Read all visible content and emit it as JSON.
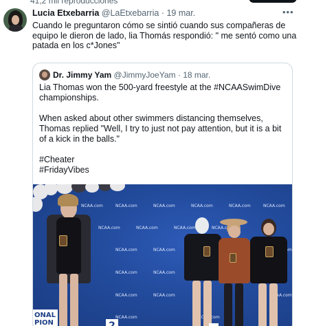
{
  "top": {
    "views_text": "41,2 mil reproducciones"
  },
  "tweet": {
    "author_name": "Lucia Etxebarria",
    "author_handle": "@LaEtxebarria",
    "separator": "·",
    "date": "19 mar.",
    "more_icon": "more-dots-icon",
    "text": "Cuando le preguntaron cómo se sintió cuando sus compañeras de equipo le dieron de lado, lia Thomás respondió: \" me sentó como una patada en los c*Jones\""
  },
  "quote": {
    "author_name": "Dr. Jimmy Yam",
    "author_handle": "@JimmyJoeYam",
    "separator": "·",
    "date": "18 mar.",
    "para1": "Lia Thomas won the 500-yard freestyle at the #NCAASwimDive championships.",
    "para2": "When asked about other swimmers distancing themselves, Thomas replied \"Well, I try to just not pay attention, but it is a bit of a kick in the balls.\"",
    "hashtag1": "#Cheater",
    "hashtag2": "#FridayVibes"
  },
  "photo": {
    "backdrop_logo_text": "NCAA.com",
    "banner_line1": "ONAL",
    "banner_line2": "PION",
    "podium_number": "2",
    "colors": {
      "backdrop": "#1d3f86",
      "logo": "#dfe8ff"
    }
  }
}
